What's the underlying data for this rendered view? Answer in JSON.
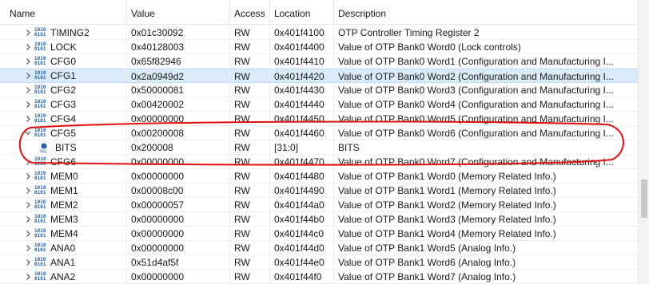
{
  "columns": {
    "name": "Name",
    "value": "Value",
    "access": "Access",
    "location": "Location",
    "description": "Description"
  },
  "rows": [
    {
      "name": "TIMING2",
      "value": "0x01c30092",
      "access": "RW",
      "location": "0x401f4100",
      "description": "OTP Controller Timing Register 2",
      "expanded": false,
      "kind": "register"
    },
    {
      "name": "LOCK",
      "value": "0x40128003",
      "access": "RW",
      "location": "0x401f4400",
      "description": "Value of OTP Bank0 Word0 (Lock controls)",
      "expanded": false,
      "kind": "register"
    },
    {
      "name": "CFG0",
      "value": "0x65f82946",
      "access": "RW",
      "location": "0x401f4410",
      "description": "Value of OTP Bank0 Word1 (Configuration and Manufacturing I...",
      "expanded": false,
      "kind": "register"
    },
    {
      "name": "CFG1",
      "value": "0x2a0949d2",
      "access": "RW",
      "location": "0x401f4420",
      "description": "Value of OTP Bank0 Word2 (Configuration and Manufacturing I...",
      "expanded": false,
      "kind": "register",
      "selected": true
    },
    {
      "name": "CFG2",
      "value": "0x50000081",
      "access": "RW",
      "location": "0x401f4430",
      "description": "Value of OTP Bank0 Word3 (Configuration and Manufacturing I...",
      "expanded": false,
      "kind": "register"
    },
    {
      "name": "CFG3",
      "value": "0x00420002",
      "access": "RW",
      "location": "0x401f4440",
      "description": "Value of OTP Bank0 Word4 (Configuration and Manufacturing I...",
      "expanded": false,
      "kind": "register"
    },
    {
      "name": "CFG4",
      "value": "0x00000000",
      "access": "RW",
      "location": "0x401f4450",
      "description": "Value of OTP Bank0 Word5 (Configuration and Manufacturing I...",
      "expanded": false,
      "kind": "register"
    },
    {
      "name": "CFG5",
      "value": "0x00200008",
      "access": "RW",
      "location": "0x401f4460",
      "description": "Value of OTP Bank0 Word6 (Configuration and Manufacturing I...",
      "expanded": true,
      "kind": "register"
    },
    {
      "name": "BITS",
      "value": "0x200008",
      "access": "RW",
      "location": "[31:0]",
      "description": "BITS",
      "expanded": false,
      "kind": "field"
    },
    {
      "name": "CFG6",
      "value": "0x00000000",
      "access": "RW",
      "location": "0x401f4470",
      "description": "Value of OTP Bank0 Word7 (Configuration and Manufacturing I...",
      "expanded": false,
      "kind": "register"
    },
    {
      "name": "MEM0",
      "value": "0x00000000",
      "access": "RW",
      "location": "0x401f4480",
      "description": "Value of OTP Bank1 Word0 (Memory Related Info.)",
      "expanded": false,
      "kind": "register"
    },
    {
      "name": "MEM1",
      "value": "0x00008c00",
      "access": "RW",
      "location": "0x401f4490",
      "description": "Value of OTP Bank1 Word1 (Memory Related Info.)",
      "expanded": false,
      "kind": "register"
    },
    {
      "name": "MEM2",
      "value": "0x00000057",
      "access": "RW",
      "location": "0x401f44a0",
      "description": "Value of OTP Bank1 Word2 (Memory Related Info.)",
      "expanded": false,
      "kind": "register"
    },
    {
      "name": "MEM3",
      "value": "0x00000000",
      "access": "RW",
      "location": "0x401f44b0",
      "description": "Value of OTP Bank1 Word3 (Memory Related Info.)",
      "expanded": false,
      "kind": "register"
    },
    {
      "name": "MEM4",
      "value": "0x00000000",
      "access": "RW",
      "location": "0x401f44c0",
      "description": "Value of OTP Bank1 Word4 (Memory Related Info.)",
      "expanded": false,
      "kind": "register"
    },
    {
      "name": "ANA0",
      "value": "0x00000000",
      "access": "RW",
      "location": "0x401f44d0",
      "description": "Value of OTP Bank1 Word5 (Analog Info.)",
      "expanded": false,
      "kind": "register"
    },
    {
      "name": "ANA1",
      "value": "0x51d4af5f",
      "access": "RW",
      "location": "0x401f44e0",
      "description": "Value of OTP Bank1 Word6 (Analog Info.)",
      "expanded": false,
      "kind": "register"
    },
    {
      "name": "ANA2",
      "value": "0x00000000",
      "access": "RW",
      "location": "0x401f44f0",
      "description": "Value of OTP Bank1 Word7 (Analog Info.)",
      "expanded": false,
      "kind": "register"
    }
  ],
  "icons": {
    "register": "binary-register-icon",
    "field": "bit-field-icon",
    "collapsed": "chevron-right-icon",
    "expanded": "chevron-down-icon"
  },
  "colors": {
    "selection": "#dcebfb",
    "annotation": "#e01010",
    "icon_blue": "#1f5fa8"
  }
}
